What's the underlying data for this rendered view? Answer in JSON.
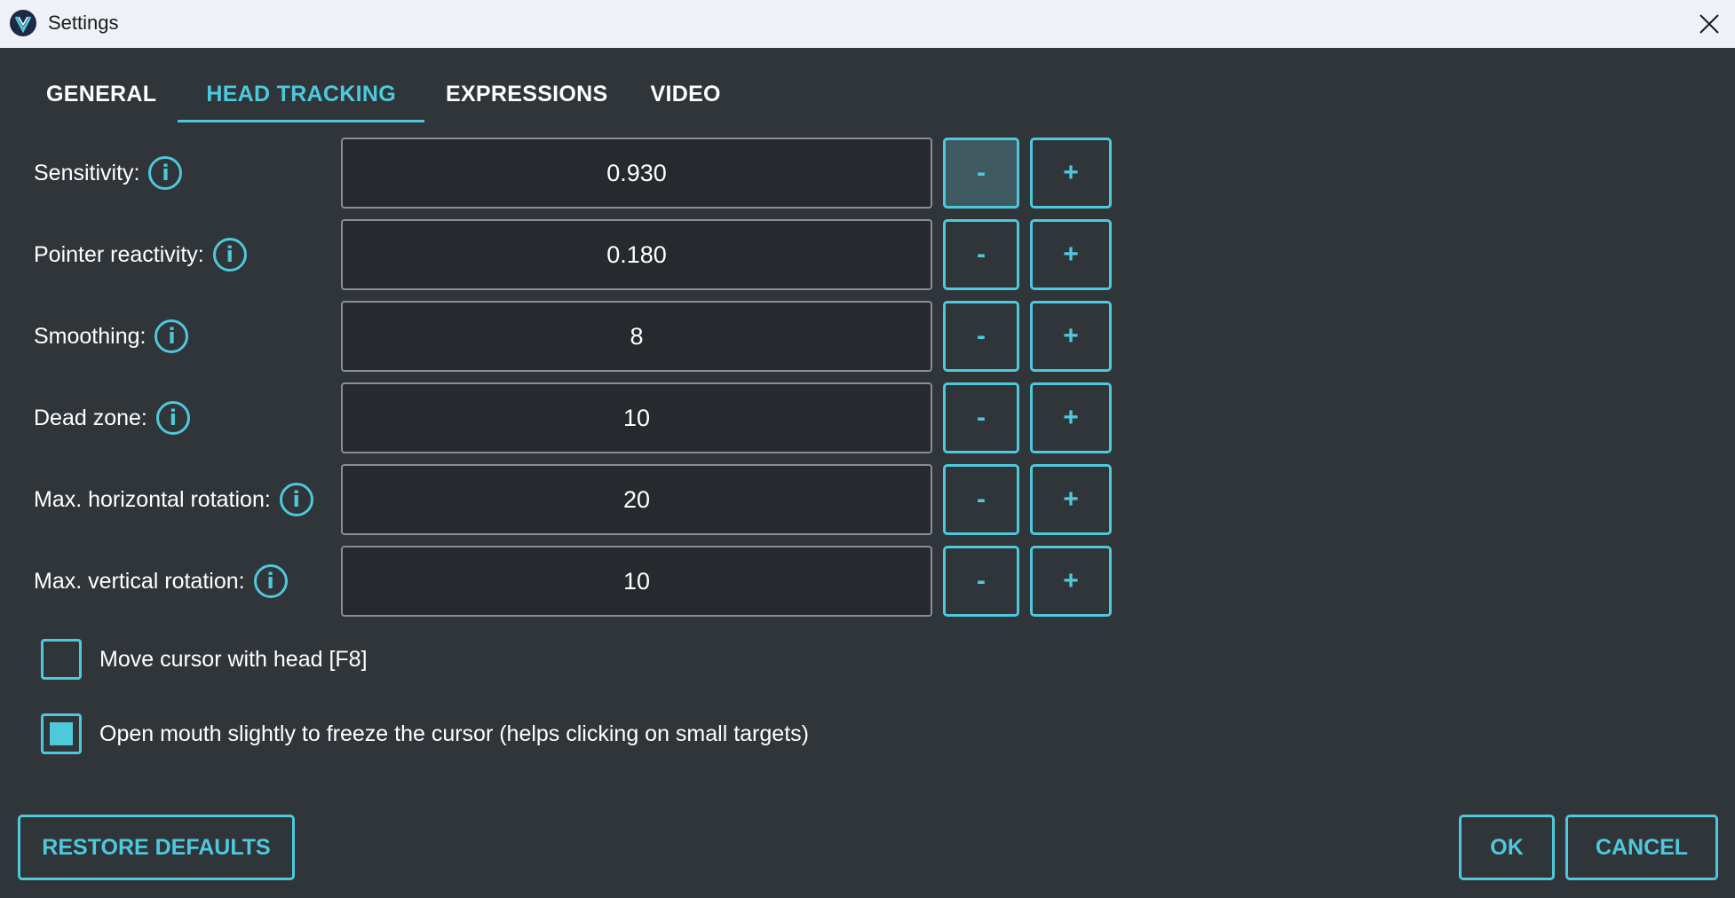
{
  "window": {
    "title": "Settings"
  },
  "colors": {
    "accent": "#4ec9dc",
    "background": "#30353a",
    "titlebar": "#eef1f7"
  },
  "tabs": [
    {
      "label": "GENERAL",
      "active": false
    },
    {
      "label": "HEAD TRACKING",
      "active": true
    },
    {
      "label": "EXPRESSIONS",
      "active": false
    },
    {
      "label": "VIDEO",
      "active": false
    }
  ],
  "settings": [
    {
      "label": "Sensitivity:",
      "value": "0.930"
    },
    {
      "label": "Pointer reactivity:",
      "value": "0.180"
    },
    {
      "label": "Smoothing:",
      "value": "8"
    },
    {
      "label": "Dead zone:",
      "value": "10"
    },
    {
      "label": "Max. horizontal rotation:",
      "value": "20"
    },
    {
      "label": "Max. vertical rotation:",
      "value": "10"
    }
  ],
  "stepper": {
    "minus": "-",
    "plus": "+"
  },
  "info_glyph": "i",
  "checkboxes": [
    {
      "label": "Move cursor with head [F8]",
      "checked": false
    },
    {
      "label": "Open mouth slightly to freeze the cursor (helps clicking on small targets)",
      "checked": true
    }
  ],
  "buttons": {
    "restore": "RESTORE DEFAULTS",
    "ok": "OK",
    "cancel": "CANCEL"
  },
  "icons": {
    "app": "app-logo-icon",
    "close": "close-icon",
    "info": "info-icon"
  }
}
